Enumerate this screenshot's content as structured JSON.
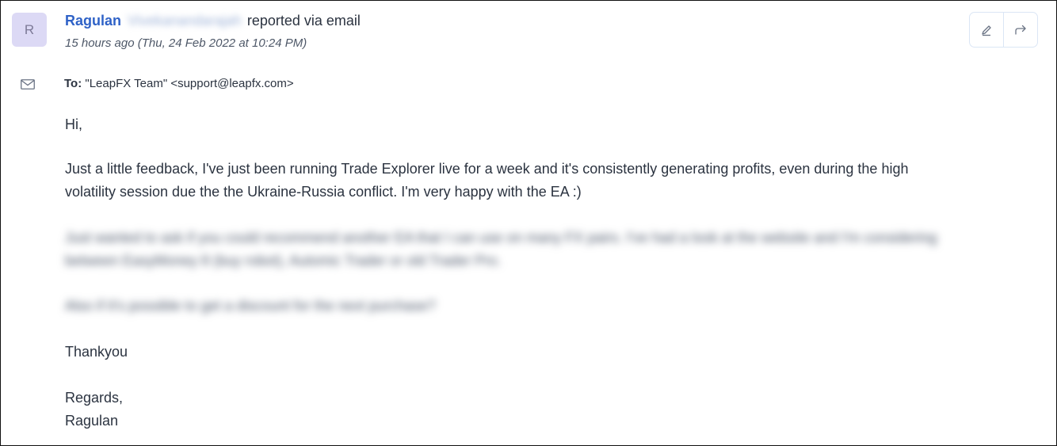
{
  "avatar": {
    "initial": "R"
  },
  "header": {
    "sender_name": "Ragulan",
    "sender_surname_redacted": "Vivekanandarajah",
    "action_text": "reported via email",
    "timestamp": "15 hours ago (Thu, 24 Feb 2022 at 10:24 PM)"
  },
  "recipient": {
    "label": "To:",
    "value": "\"LeapFX Team\" <support@leapfx.com>"
  },
  "message": {
    "greeting": "Hi,",
    "paragraph1_line1": "Just a little feedback, I've just been running Trade Explorer live for a week and it's consistently generating profits, even during the high",
    "paragraph1_line2": "volatility session due the the Ukraine-Russia conflict. I'm very happy with the EA :)",
    "blurred_paragraph_line1": "Just wanted to ask if you could recommend another EA that I can use on many FX pairs. I've had a look at the website and I'm considering",
    "blurred_paragraph_line2": "between EasyMoney 8 (buy robot), Automic Trader or old Trader Pro.",
    "blurred_paragraph2": "Also if it's possible to get a discount for the next purchase?",
    "thanks": "Thankyou",
    "signoff": "Regards,",
    "signature": "Ragulan"
  },
  "icons": {
    "edit": "pencil-icon",
    "forward": "forward-arrow-icon",
    "mail": "envelope-icon"
  },
  "colors": {
    "sender": "#2f62c7",
    "avatar_bg": "#dcd9f5",
    "text": "#2b3340"
  }
}
